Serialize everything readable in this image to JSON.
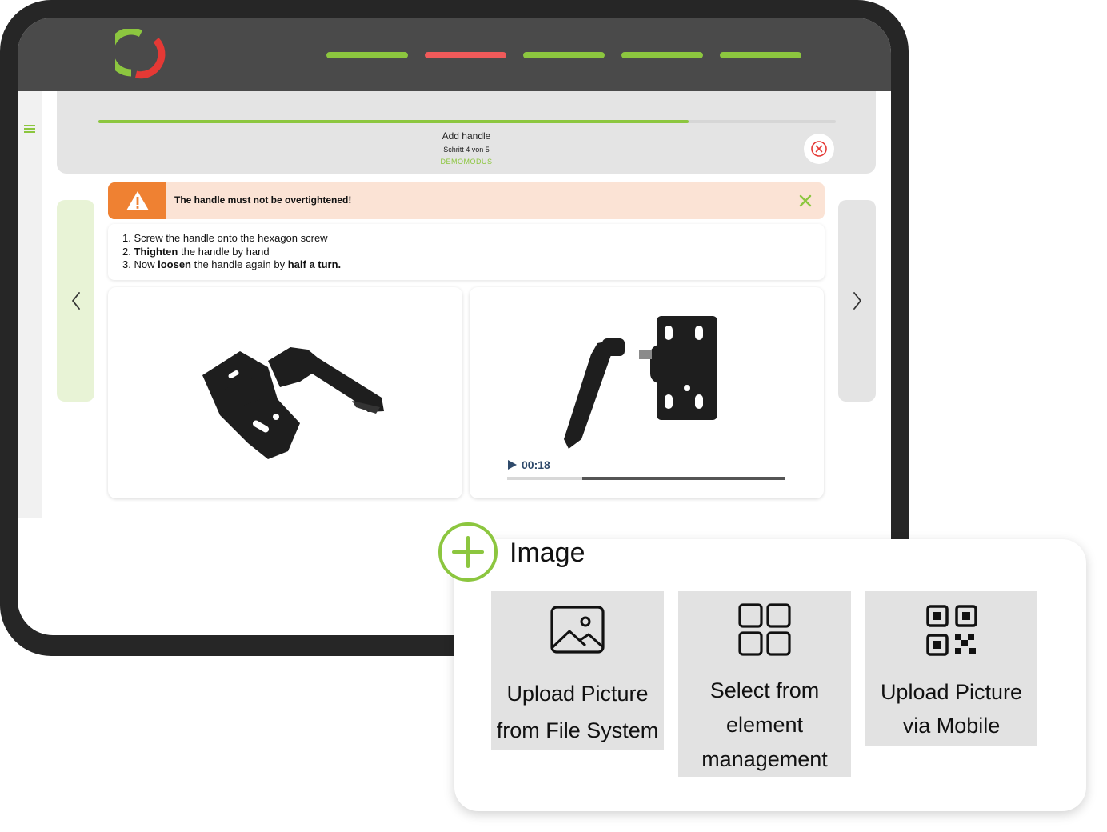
{
  "colors": {
    "accent_green": "#8cc63f",
    "accent_red": "#e53935",
    "warning_orange": "#ef8132",
    "warning_bg": "#fbe3d5"
  },
  "header": {
    "step_title": "Add handle",
    "step_count": "Schritt 4 von 5",
    "mode": "DEMOMODUS",
    "progress": 0.8
  },
  "warning": {
    "text": "The handle must not be overtightened!"
  },
  "instructions": {
    "items": [
      {
        "num": "1.",
        "parts": [
          {
            "text": "Screw the handle onto the hexagon screw",
            "bold": false
          }
        ]
      },
      {
        "num": "2.",
        "parts": [
          {
            "text": "Thighten",
            "bold": true
          },
          {
            "text": " the handle by hand",
            "bold": false
          }
        ]
      },
      {
        "num": "3.",
        "parts": [
          {
            "text": "Now ",
            "bold": false
          },
          {
            "text": "loosen",
            "bold": true
          },
          {
            "text": " the handle again by ",
            "bold": false
          },
          {
            "text": "half a turn.",
            "bold": true
          }
        ]
      }
    ]
  },
  "video": {
    "time": "00:18",
    "progress_start": 0.27,
    "progress_end": 1.0
  },
  "popup": {
    "title": "Image",
    "options": [
      {
        "label_line1": "Upload Picture",
        "label_line2": "from File System",
        "icon": "image-icon"
      },
      {
        "label_line1": "Select from",
        "label_line2": "element",
        "label_line3": "management",
        "icon": "grid-icon"
      },
      {
        "label_line1": "Upload Picture",
        "label_line2": "via Mobile",
        "icon": "qr-code-icon"
      }
    ]
  },
  "icons": {
    "logo": "app-logo",
    "menu": "hamburger-icon",
    "close": "close-circle-icon",
    "warning": "warning-triangle-icon",
    "dismiss": "close-x-icon",
    "prev": "chevron-left-icon",
    "next": "chevron-right-icon",
    "add": "plus-circle-icon",
    "play": "play-icon"
  }
}
